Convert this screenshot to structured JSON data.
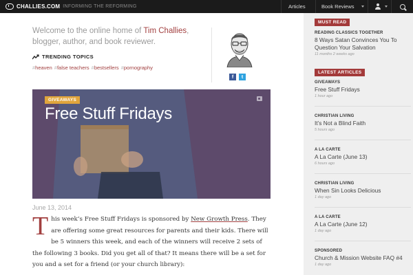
{
  "brand": {
    "name": "CHALLIES.COM",
    "tagline": "INFORMING THE REFORMING"
  },
  "nav": {
    "articles": "Articles",
    "book_reviews": "Book Reviews"
  },
  "welcome": {
    "prefix": "Welcome to the online home of ",
    "author": "Tim Challies",
    "suffix": ", blogger, author, and book reviewer."
  },
  "trending": {
    "title": "TRENDING TOPICS",
    "topics": [
      "heaven",
      "false teachers",
      "bestsellers",
      "pornography"
    ]
  },
  "social": {
    "facebook": "f",
    "twitter": "t"
  },
  "hero": {
    "badge": "GIVEAWAYS",
    "title": "Free Stuff Fridays"
  },
  "post": {
    "date": "June 13, 2014",
    "dropcap": "T",
    "body_start": "his week’s Free Stuff Fridays is sponsored by ",
    "sponsor": "New Growth Press",
    "body_end": ". They are offering some great resources for parents and their kids. There will be 5 winners this week, and each of the winners will receive 2 sets of the following 3 books. Did you get all of that? It means there will be a set for you and a set for a friend (or your church library):"
  },
  "sidebar": {
    "must_read_label": "MUST READ",
    "must_read": {
      "category": "READING CLASSICS TOGETHER",
      "title": "8 Ways Satan Convinces You To Question Your Salvation",
      "time": "11 months 2 weeks ago"
    },
    "latest_label": "LATEST ARTICLES",
    "latest": [
      {
        "category": "GIVEAWAYS",
        "title": "Free Stuff Fridays",
        "time": "1 hour ago"
      },
      {
        "category": "CHRISTIAN LIVING",
        "title": "It’s Not a Blind Faith",
        "time": "5 hours ago"
      },
      {
        "category": "A LA CARTE",
        "title": "A La Carte (June 13)",
        "time": "6 hours ago"
      },
      {
        "category": "CHRISTIAN LIVING",
        "title": "When Sin Looks Delicious",
        "time": "1 day ago"
      },
      {
        "category": "A LA CARTE",
        "title": "A La Carte (June 12)",
        "time": "1 day ago"
      },
      {
        "category": "SPONSORED",
        "title": "Church & Mission Website FAQ #4",
        "time": "1 day ago"
      }
    ]
  },
  "colors": {
    "accent": "#a33a3a",
    "topbar": "#1b1b1b",
    "badge": "#e0a53c",
    "hero": "#5e4a6b",
    "sidebar": "#efefef"
  },
  "icons": {
    "logo": "challies-logo-icon",
    "user": "user-icon",
    "search": "search-icon",
    "trending": "trending-icon",
    "camera": "camera-icon"
  }
}
